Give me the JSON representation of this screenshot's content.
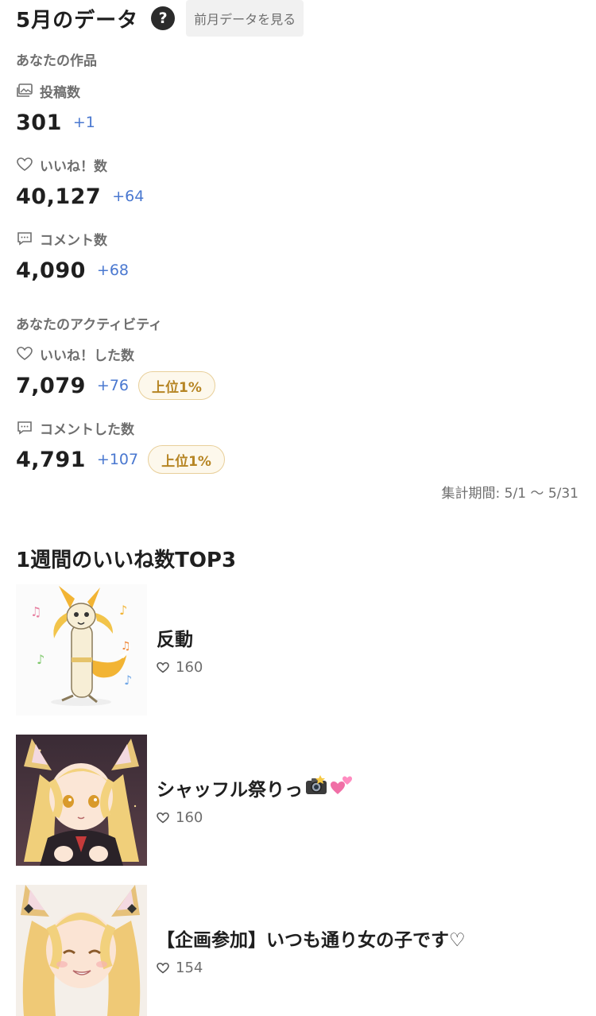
{
  "header": {
    "title": "5月のデータ",
    "help_label": "?",
    "prev_button": "前月データを見る"
  },
  "your_works": {
    "section_label": "あなたの作品",
    "metrics": [
      {
        "icon": "image-stack-icon",
        "label": "投稿数",
        "value": "301",
        "delta": "+1"
      },
      {
        "icon": "heart-icon",
        "label": "いいね！数",
        "value": "40,127",
        "delta": "+64"
      },
      {
        "icon": "comment-icon",
        "label": "コメント数",
        "value": "4,090",
        "delta": "+68"
      }
    ]
  },
  "your_activity": {
    "section_label": "あなたのアクティビティ",
    "metrics": [
      {
        "icon": "heart-icon",
        "label": "いいね！した数",
        "value": "7,079",
        "delta": "+76",
        "rank": "上位1%"
      },
      {
        "icon": "comment-icon",
        "label": "コメントした数",
        "value": "4,791",
        "delta": "+107",
        "rank": "上位1%"
      }
    ]
  },
  "period": "集計期間: 5/1 〜 5/31",
  "top3": {
    "title": "1週間のいいね数TOP3",
    "works": [
      {
        "title": "反動",
        "likes": "160",
        "thumb": "cartoon-fox-thumbnail"
      },
      {
        "title": "シャッフル祭りっ",
        "emoji_icons": [
          "camera-flash-icon",
          "two-hearts-icon"
        ],
        "likes": "160",
        "thumb": "fox-girl-thumbnail"
      },
      {
        "title": "【企画参加】いつも通り女の子です♡",
        "likes": "154",
        "thumb": "fox-girl-smile-thumbnail"
      }
    ]
  },
  "colors": {
    "accent_blue": "#4a78d0",
    "rank_gold": "#b68524",
    "rank_bg": "#fdf8ec",
    "muted_text": "#6e6e6e"
  }
}
